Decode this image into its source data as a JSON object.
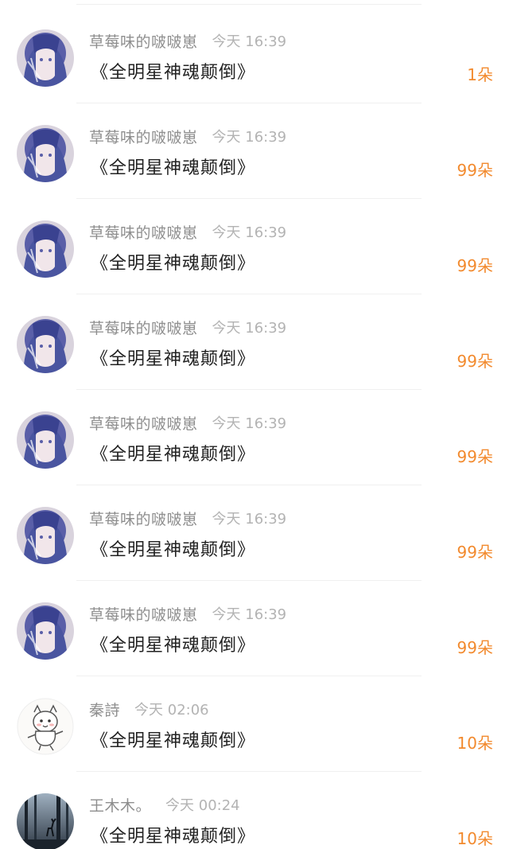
{
  "comments": [
    {
      "username": "草莓味的啵啵崽",
      "time": "今天 16:39",
      "title": "《全明星神魂颠倒》",
      "count": "1朵",
      "avatar": "anime-girl-avatar"
    },
    {
      "username": "草莓味的啵啵崽",
      "time": "今天 16:39",
      "title": "《全明星神魂颠倒》",
      "count": "99朵",
      "avatar": "anime-girl-avatar"
    },
    {
      "username": "草莓味的啵啵崽",
      "time": "今天 16:39",
      "title": "《全明星神魂颠倒》",
      "count": "99朵",
      "avatar": "anime-girl-avatar"
    },
    {
      "username": "草莓味的啵啵崽",
      "time": "今天 16:39",
      "title": "《全明星神魂颠倒》",
      "count": "99朵",
      "avatar": "anime-girl-avatar"
    },
    {
      "username": "草莓味的啵啵崽",
      "time": "今天 16:39",
      "title": "《全明星神魂颠倒》",
      "count": "99朵",
      "avatar": "anime-girl-avatar"
    },
    {
      "username": "草莓味的啵啵崽",
      "time": "今天 16:39",
      "title": "《全明星神魂颠倒》",
      "count": "99朵",
      "avatar": "anime-girl-avatar"
    },
    {
      "username": "草莓味的啵啵崽",
      "time": "今天 16:39",
      "title": "《全明星神魂颠倒》",
      "count": "99朵",
      "avatar": "anime-girl-avatar"
    },
    {
      "username": "秦詩",
      "time": "今天 02:06",
      "title": "《全明星神魂颠倒》",
      "count": "10朵",
      "avatar": "cartoon-dog-avatar"
    },
    {
      "username": "王木木。",
      "time": "今天 00:24",
      "title": "《全明星神魂颠倒》",
      "count": "10朵",
      "avatar": "dark-forest-avatar"
    }
  ],
  "colors": {
    "username": "#8e8e8e",
    "time": "#b3b3b3",
    "title": "#222222",
    "count_accent": "#f28a2e",
    "divider": "#f0f0f0"
  }
}
